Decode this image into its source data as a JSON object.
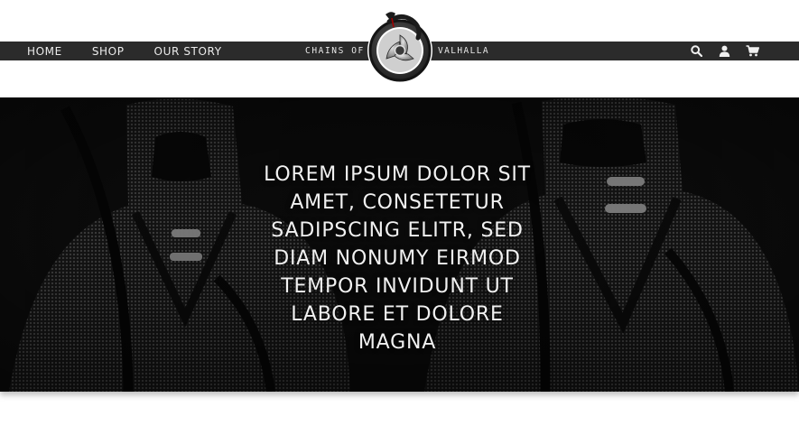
{
  "nav": {
    "links": [
      {
        "label": "HOME"
      },
      {
        "label": "SHOP"
      },
      {
        "label": "OUR STORY"
      }
    ],
    "brand_left": "CHAINS OF",
    "brand_right": "VALHALLA",
    "icons": [
      "search-icon",
      "user-icon",
      "cart-icon"
    ]
  },
  "hero": {
    "headline": "LOREM IPSUM DOLOR SIT AMET, CONSETETUR SADIPSCING ELITR, SED DIAM NONUMY EIRMOD TEMPOR INVIDUNT UT LABORE ET DOLORE MAGNA"
  },
  "colors": {
    "navbar": "#2b2b2b",
    "nav_text": "#ececec",
    "hero_background": "#0f0f0f",
    "hero_text": "#f1f1f1"
  }
}
